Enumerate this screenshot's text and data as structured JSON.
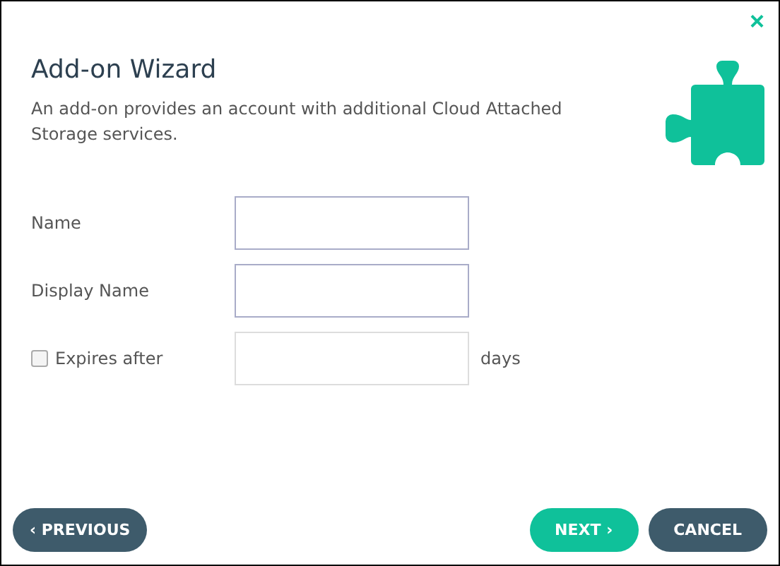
{
  "close": "×",
  "title": "Add-on Wizard",
  "description": "An add-on provides an account with additional Cloud Attached Storage services.",
  "fields": [
    {
      "kind": "text",
      "label": "Name",
      "disabled": false
    },
    {
      "kind": "text",
      "label": "Display Name",
      "disabled": false
    },
    {
      "kind": "checkbox",
      "label": "Expires after",
      "checked": false,
      "disabled": true,
      "suffix": "days"
    }
  ],
  "buttons": [
    {
      "label": "‹ PREVIOUS",
      "kind": "secondary"
    },
    {
      "label": "NEXT ›",
      "kind": "primary"
    },
    {
      "label": "CANCEL",
      "kind": "secondary"
    }
  ]
}
